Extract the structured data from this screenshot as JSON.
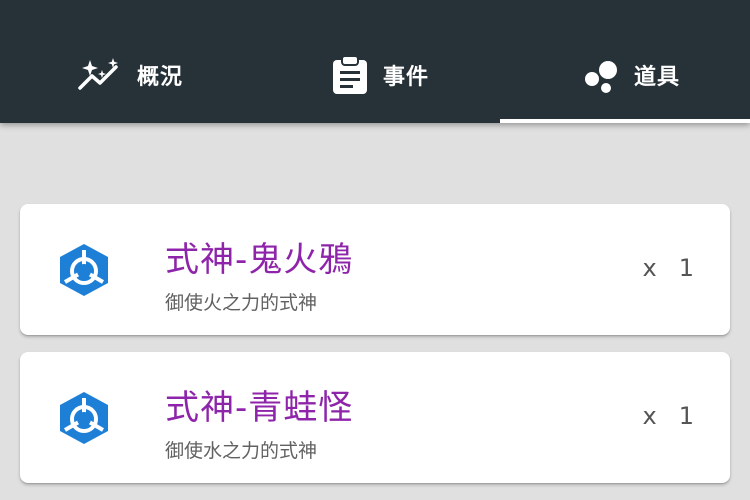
{
  "tabs": [
    {
      "label": "概況",
      "icon": "insights-icon",
      "active": false
    },
    {
      "label": "事件",
      "icon": "clipboard-icon",
      "active": false
    },
    {
      "label": "道具",
      "icon": "bubbles-icon",
      "active": true
    }
  ],
  "items": [
    {
      "title": "式神-鬼火鴉",
      "description": "御使火之力的式神",
      "qty_prefix": "x",
      "qty": "1",
      "icon": "cube-icon"
    },
    {
      "title": "式神-青蛙怪",
      "description": "御使水之力的式神",
      "qty_prefix": "x",
      "qty": "1",
      "icon": "cube-icon"
    }
  ],
  "colors": {
    "topbar": "#263238",
    "background": "#e0e0e0",
    "title": "#8e24aa",
    "icon": "#1e7fd6"
  }
}
